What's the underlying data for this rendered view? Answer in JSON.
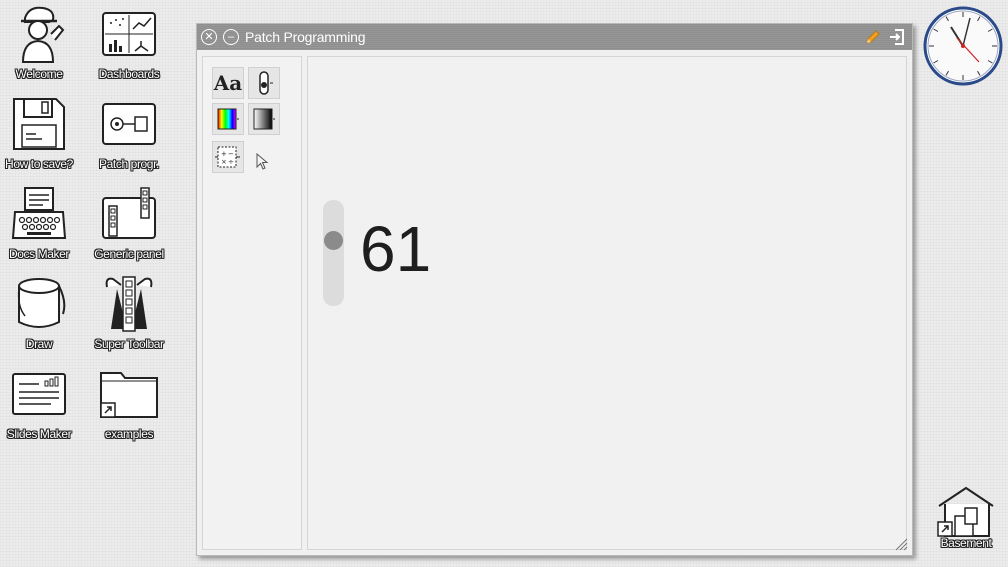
{
  "desktop": {
    "icons": [
      {
        "label": "Welcome",
        "icon": "welcome-figure-icon"
      },
      {
        "label": "Dashboards",
        "icon": "dashboards-icon"
      },
      {
        "label": "How to save?",
        "icon": "floppy-disk-icon"
      },
      {
        "label": "Patch progr.",
        "icon": "patch-programming-icon"
      },
      {
        "label": "Docs Maker",
        "icon": "typewriter-icon"
      },
      {
        "label": "Generic panel",
        "icon": "generic-panel-icon"
      },
      {
        "label": "Draw",
        "icon": "paint-bucket-icon"
      },
      {
        "label": "Super Toolbar",
        "icon": "super-toolbar-icon"
      },
      {
        "label": "Slides Maker",
        "icon": "slides-icon"
      },
      {
        "label": "examples",
        "icon": "folder-shortcut-icon"
      }
    ],
    "basement": {
      "label": "Basement",
      "icon": "basement-house-icon"
    }
  },
  "window": {
    "title": "Patch Programming",
    "toolbox": [
      {
        "name": "text-tool",
        "glyph": "Aa"
      },
      {
        "name": "slider-tool"
      },
      {
        "name": "color-spectrum-tool"
      },
      {
        "name": "gradient-tool"
      },
      {
        "name": "calculator-tool"
      },
      {
        "name": "pointer-tool"
      }
    ],
    "slider_value": 61,
    "slider_fraction": 0.35,
    "readout": "61"
  },
  "colors": {
    "titlebar": "#8e8e8e",
    "edit_pencil": "#f0a020",
    "clock_rim": "#2a4a8a",
    "clock_second_hand": "#d02020"
  }
}
